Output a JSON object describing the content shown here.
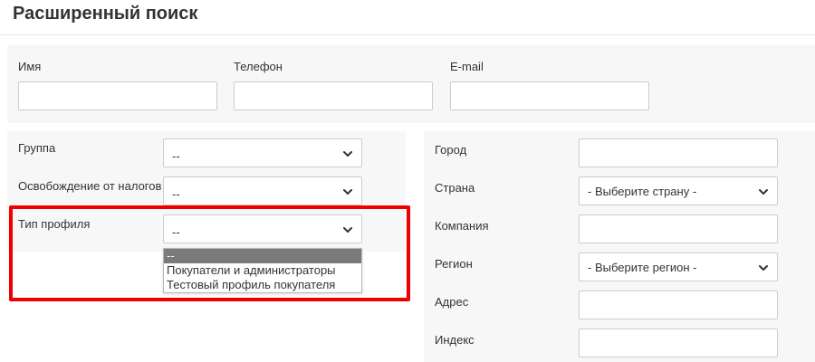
{
  "title": "Расширенный поиск",
  "fields": {
    "name": {
      "label": "Имя",
      "value": "",
      "placeholder": ""
    },
    "phone": {
      "label": "Телефон",
      "value": "",
      "placeholder": ""
    },
    "email": {
      "label": "E-mail",
      "value": "",
      "placeholder": ""
    },
    "group": {
      "label": "Группа",
      "value": "--"
    },
    "tax_exempt": {
      "label": "Освобождение от налогов",
      "value": "--"
    },
    "profile_type": {
      "label": "Тип профиля",
      "value": "--",
      "options": [
        "--",
        "Покупатели и администраторы",
        "Тестовый профиль покупателя"
      ]
    },
    "city": {
      "label": "Город",
      "value": ""
    },
    "country": {
      "label": "Страна",
      "value": "- Выберите страну -"
    },
    "company": {
      "label": "Компания",
      "value": ""
    },
    "region": {
      "label": "Регион",
      "value": "- Выберите регион -"
    },
    "address": {
      "label": "Адрес",
      "value": ""
    },
    "zip": {
      "label": "Индекс",
      "value": ""
    }
  },
  "colors": {
    "highlight": "#ee0000",
    "panel_background": "#f7f7f7",
    "selected_option": "#7a7a7a"
  },
  "icons": {
    "dropdown": "chevron-down-icon"
  }
}
